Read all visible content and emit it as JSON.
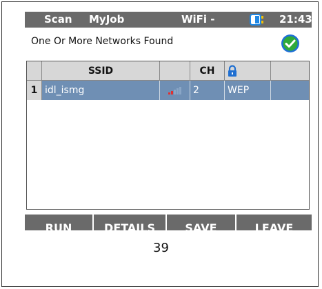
{
  "statusbar": {
    "mode": "Scan",
    "job": "MyJob",
    "connection": "WiFi -",
    "time": "21:43",
    "battery_icon": "battery-icon"
  },
  "banner": {
    "message": "One Or More Networks Found",
    "status_icon": "check-circle-icon",
    "status_color": "#2eaa3a"
  },
  "table": {
    "headers": [
      "SSID",
      "",
      "CH",
      "lock-icon",
      ""
    ],
    "rows": [
      {
        "index": "1",
        "ssid": "idl_ismg",
        "signal_icon": "signal-strength-icon",
        "channel": "2",
        "security": "WEP",
        "extra": ""
      }
    ],
    "selected_row_color": "#6f8fb4"
  },
  "buttons": {
    "run": "RUN",
    "details": "DETAILS",
    "save": "SAVE",
    "leave": "LEAVE"
  },
  "page": {
    "number": "39"
  },
  "colors": {
    "bar_gray": "#6a6a6a",
    "header_gray": "#d7d7d7",
    "lock_blue": "#1f6fd1"
  }
}
